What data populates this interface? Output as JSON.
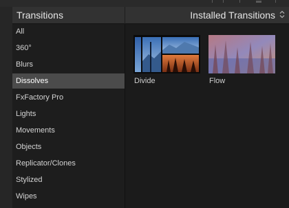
{
  "sidebar": {
    "title": "Transitions",
    "categories": [
      {
        "label": "All"
      },
      {
        "label": "360°"
      },
      {
        "label": "Blurs"
      },
      {
        "label": "Dissolves"
      },
      {
        "label": "FxFactory Pro"
      },
      {
        "label": "Lights"
      },
      {
        "label": "Movements"
      },
      {
        "label": "Objects"
      },
      {
        "label": "Replicator/Clones"
      },
      {
        "label": "Stylized"
      },
      {
        "label": "Wipes"
      }
    ],
    "selected": "Dissolves"
  },
  "content": {
    "menu_label": "Installed Transitions",
    "menu_icon": "updown-chevron-icon",
    "items": [
      {
        "label": "Divide"
      },
      {
        "label": "Flow"
      }
    ]
  },
  "colors": {
    "selected_bg": "#4b4b4b",
    "header_bg": "#323232",
    "panel_bg": "#1d1d1d"
  }
}
